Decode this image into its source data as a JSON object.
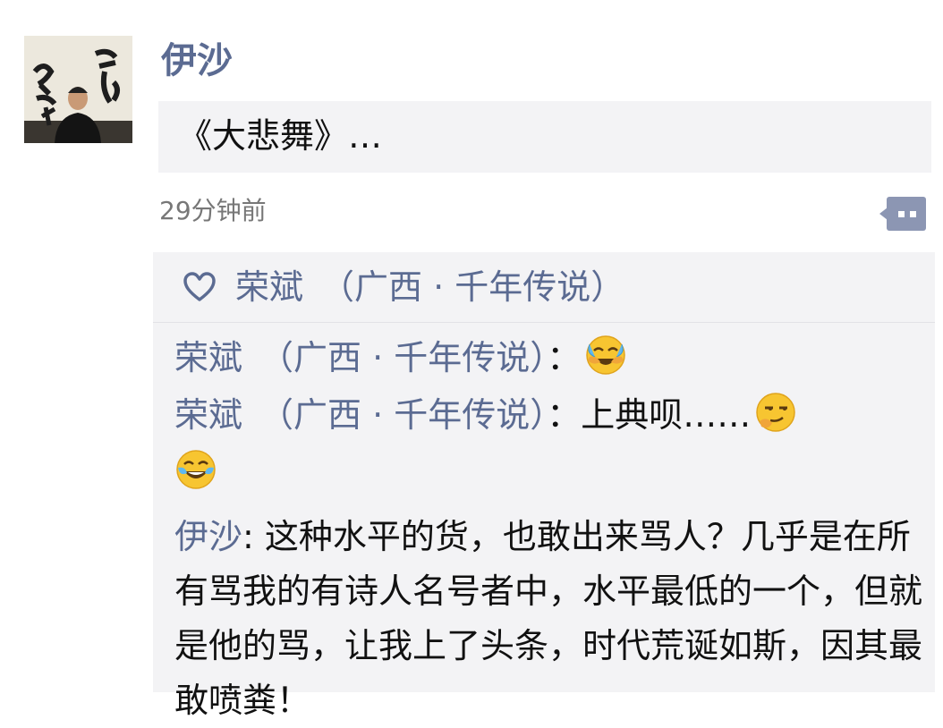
{
  "post": {
    "author": "伊沙",
    "shared_title": "《大悲舞》…",
    "time": "29分钟前"
  },
  "likes": {
    "names": "荣斌　（广西 · 千年传说）"
  },
  "comments": [
    {
      "author": "荣斌　（广西 · 千年传说）",
      "sep": "：",
      "text": "",
      "emoji": [
        "crying-laughing-emoji"
      ]
    },
    {
      "author": "荣斌　（广西 · 千年传说）",
      "sep": "：",
      "text": "上典呗……",
      "emoji": [
        "smirk-emoji",
        "laughing-tears-emoji"
      ]
    },
    {
      "author": "伊沙",
      "sep": ": ",
      "text": "这种水平的货，也敢出来骂人？几乎是在所有骂我的有诗人名号者中，水平最低的一个，但就是他的骂，让我上了头条，时代荒诞如斯，因其最敢喷粪！",
      "emoji": []
    }
  ],
  "colors": {
    "name_blue": "#5b6b92",
    "panel_bg": "#f3f3f5",
    "time_gray": "#777777",
    "comment_icon": "#8c96b3"
  }
}
